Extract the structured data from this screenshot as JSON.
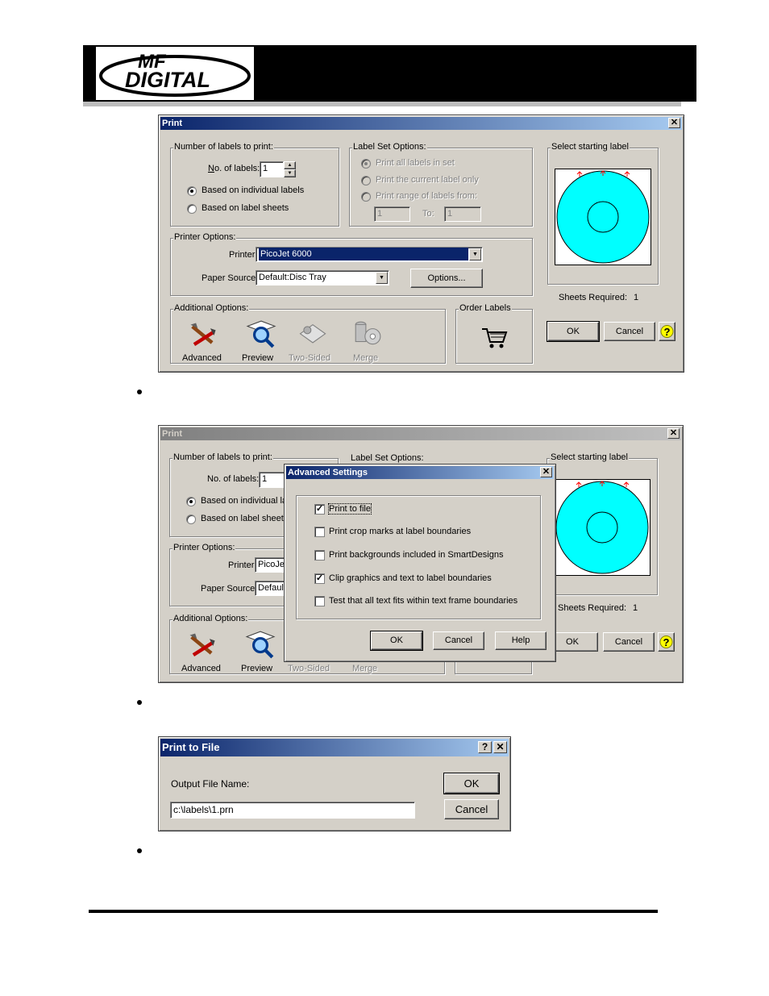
{
  "brand": {
    "logo_line1": "MF",
    "logo_line2": "DIGITAL"
  },
  "print1": {
    "title": "Print",
    "num_group": "Number of labels to print:",
    "num_label_pre": "",
    "num_label_u": "N",
    "num_label_post": "o. of labels:",
    "num_value": "1",
    "radio_individual": "Based on individual labels",
    "radio_sheets": "Based on label sheets",
    "set_group": "Label Set Options:",
    "set_all": "Print all labels in set",
    "set_current": "Print the current label only",
    "set_range": "Print range of labels from:",
    "range_from": "1",
    "range_to_label": "To:",
    "range_to": "1",
    "start_group": "Select starting label",
    "printer_group": "Printer Options:",
    "printer_label": "Printer:",
    "printer_value": "PicoJet 6000",
    "paper_label": "Paper Source:",
    "paper_value": "Default:Disc Tray",
    "options_btn": "Options...",
    "sheets_label": "Sheets Required:",
    "sheets_value": "1",
    "additional_group": "Additional Options:",
    "advanced": "Advanced",
    "preview": "Preview",
    "two_sided": "Two-Sided",
    "merge": "Merge",
    "order_group": "Order Labels",
    "ok": "OK",
    "cancel": "Cancel"
  },
  "print2": {
    "title": "Print",
    "num_group": "Number of labels to print:",
    "num_label": "No. of labels:",
    "num_value": "1",
    "radio_individual": "Based on individual lab",
    "radio_sheets": "Based on label sheets",
    "set_group": "Label Set Options:",
    "start_group": "Select starting label",
    "printer_group": "Printer Options:",
    "printer_label": "Printer:",
    "printer_value": "PicoJet",
    "paper_label": "Paper Source:",
    "paper_value": "Default",
    "sheets_label": "Sheets Required:",
    "sheets_value": "1",
    "additional_group": "Additional Options:",
    "advanced": "Advanced",
    "preview": "Preview",
    "two_sided": "Two-Sided",
    "merge": "Merge",
    "ok": "OK",
    "cancel": "Cancel"
  },
  "advanced": {
    "title": "Advanced Settings",
    "opt_print_to_file": "Print to file",
    "opt_crop_marks": "Print crop marks at label boundaries",
    "opt_backgrounds": "Print backgrounds included in SmartDesigns",
    "opt_clip": "Clip graphics and text to label boundaries",
    "opt_text_fit": "Test that all text fits within text frame boundaries",
    "checked_print_to_file": true,
    "checked_clip": true,
    "ok": "OK",
    "cancel": "Cancel",
    "help": "Help"
  },
  "print_to_file": {
    "title": "Print to File",
    "help_glyph": "?",
    "close_glyph": "✕",
    "label": "Output File Name:",
    "value": "c:\\labels\\1.prn",
    "ok": "OK",
    "cancel": "Cancel"
  },
  "colors": {
    "disc": "#00ffff",
    "title_active": "#0a246a",
    "face": "#d4d0c8"
  }
}
